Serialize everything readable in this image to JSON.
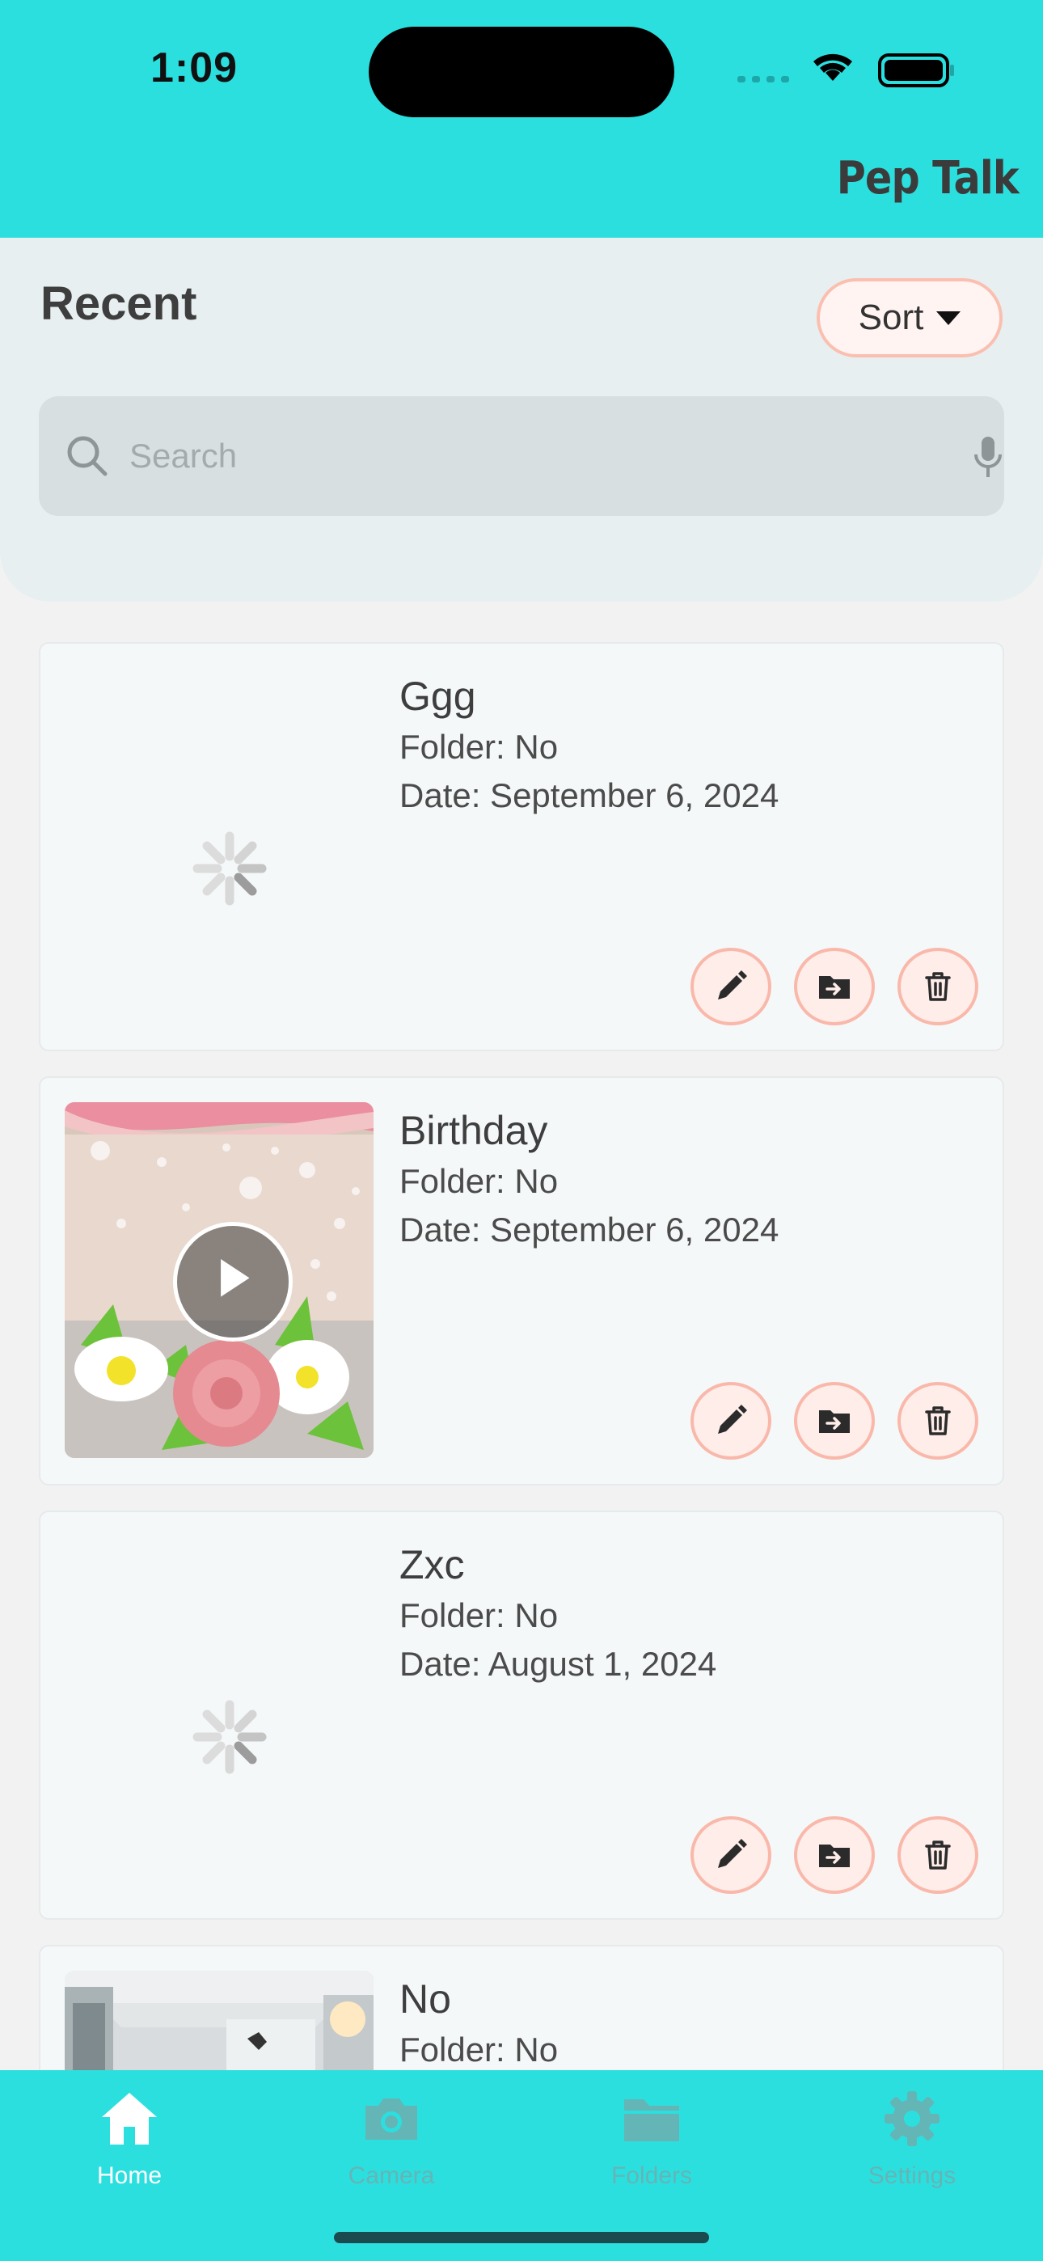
{
  "status_bar": {
    "time": "1:09"
  },
  "header": {
    "brand": "Pep Talk"
  },
  "recent": {
    "title": "Recent",
    "sort_label": "Sort",
    "search_placeholder": "Search"
  },
  "cards": [
    {
      "title": "Ggg",
      "folder": "Folder: No",
      "date": "Date: September 6, 2024",
      "media": "loading"
    },
    {
      "title": "Birthday",
      "folder": "Folder: No",
      "date": "Date: September 6, 2024",
      "media": "video-thumbnail"
    },
    {
      "title": "Zxc",
      "folder": "Folder: No",
      "date": "Date: August 1, 2024",
      "media": "loading"
    },
    {
      "title": "No",
      "folder": "Folder: No",
      "date": "",
      "media": "photo-thumbnail"
    }
  ],
  "card_actions": [
    "pencil-icon",
    "move-to-folder-icon",
    "trash-icon"
  ],
  "nav": {
    "items": [
      {
        "label": "Home",
        "icon": "home-icon",
        "active": true
      },
      {
        "label": "Camera",
        "icon": "camera-icon",
        "active": false
      },
      {
        "label": "Folders",
        "icon": "folder-icon",
        "active": false
      },
      {
        "label": "Settings",
        "icon": "gear-icon",
        "active": false
      }
    ]
  },
  "colors": {
    "accent": "#2cdfdf",
    "button_border": "#f9b8aa",
    "button_fill": "#feede9",
    "panel": "#e7eff0",
    "card": "#f5f8f9"
  }
}
